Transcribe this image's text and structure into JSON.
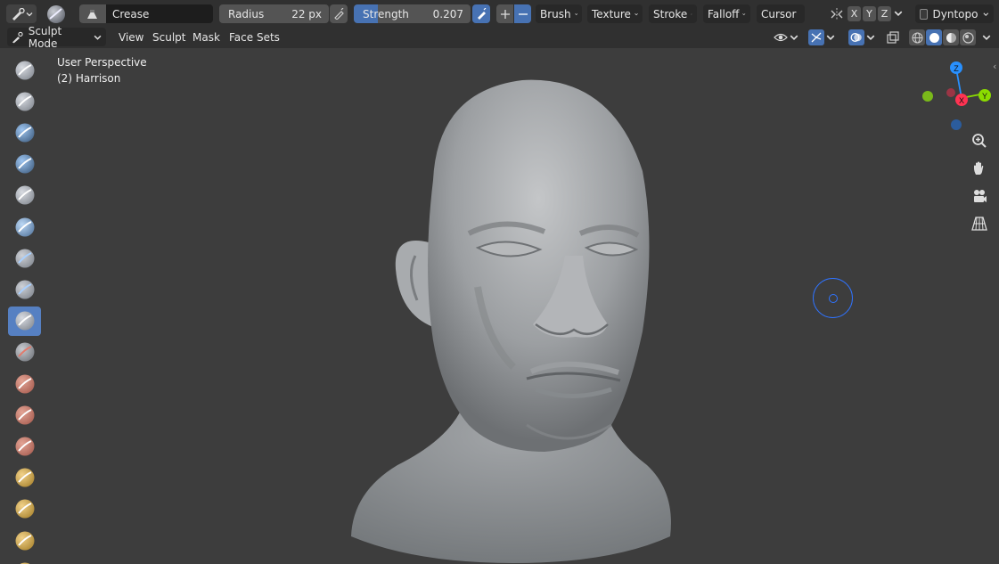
{
  "header": {
    "editor_type_icon": "sculpt-editor-icon",
    "brush_name": "Crease",
    "radius_label": "Radius",
    "radius_value": "22 px",
    "strength_label": "Strength",
    "strength_value": "0.207",
    "strength_fraction": 0.207,
    "menus": [
      "Brush",
      "Texture",
      "Stroke",
      "Falloff",
      "Cursor"
    ],
    "symmetry_axes": [
      "X",
      "Y",
      "Z"
    ],
    "dyntopo_label": "Dyntopo"
  },
  "header2": {
    "mode_label": "Sculpt Mode",
    "menus": [
      "View",
      "Sculpt",
      "Mask",
      "Face Sets"
    ]
  },
  "viewport": {
    "perspective_label": "User Perspective",
    "object_label": "(2) Harrison",
    "gizmo_axes": {
      "z": "Z",
      "x": "X",
      "y": "Y"
    }
  },
  "colors": {
    "accent": "#4772b3",
    "active_tool": "#5680c2",
    "header_bg": "#303030",
    "viewport_bg": "#3d3d3d",
    "axis_x": "#ff3352",
    "axis_y": "#8bdc00",
    "axis_z": "#2890ff"
  },
  "toolbar": {
    "tools": [
      {
        "icon": "draw-brush-icon",
        "active": false
      },
      {
        "icon": "draw-sharp-brush-icon",
        "active": false
      },
      {
        "icon": "clay-brush-icon",
        "active": false
      },
      {
        "icon": "clay-strips-brush-icon",
        "active": false
      },
      {
        "icon": "clay-thumb-brush-icon",
        "active": false
      },
      {
        "icon": "layer-brush-icon",
        "active": false
      },
      {
        "icon": "inflate-brush-icon",
        "active": false
      },
      {
        "icon": "blob-brush-icon",
        "active": false
      },
      {
        "icon": "crease-brush-icon",
        "active": true
      },
      {
        "icon": "smooth-brush-icon",
        "active": false
      },
      {
        "icon": "flatten-brush-icon",
        "active": false
      },
      {
        "icon": "fill-brush-icon",
        "active": false
      },
      {
        "icon": "scrape-brush-icon",
        "active": false
      },
      {
        "icon": "multiplane-scrape-brush-icon",
        "active": false
      },
      {
        "icon": "pinch-brush-icon",
        "active": false
      },
      {
        "icon": "grab-brush-icon",
        "active": false
      },
      {
        "icon": "elastic-deform-brush-icon",
        "active": false
      }
    ]
  }
}
